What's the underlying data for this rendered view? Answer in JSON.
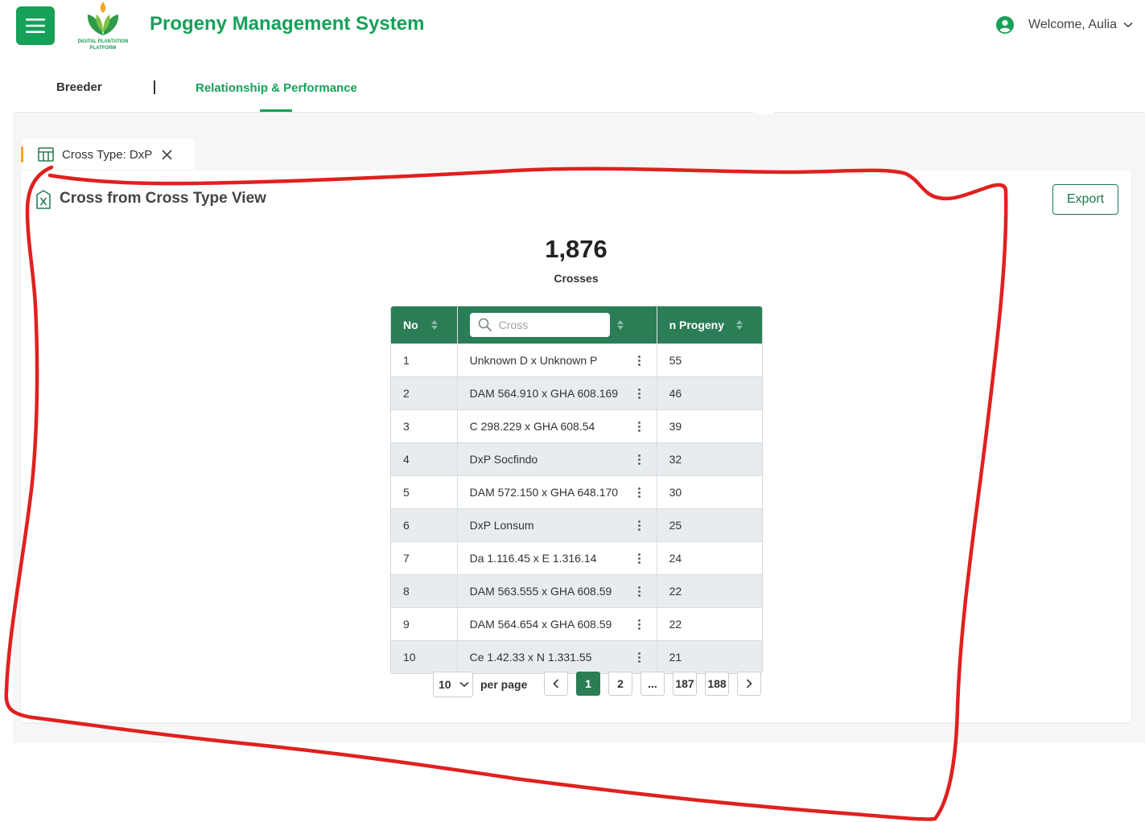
{
  "header": {
    "title": "Progeny Management System",
    "logo_caption": "DIGITAL PLANTATION PLATFORM",
    "user_greeting": "Welcome, Aulia"
  },
  "tabs": [
    {
      "label": "Breeder",
      "active": false
    },
    {
      "label": "Relationship & Performance",
      "active": true
    }
  ],
  "filter_chip": {
    "label": "Cross Type: DxP"
  },
  "card": {
    "title": "Cross from Cross Type View",
    "export_label": "Export",
    "total_value": "1,876",
    "total_label": "Crosses"
  },
  "table": {
    "columns": [
      "No",
      "Cross",
      "n Progeny"
    ],
    "search_placeholder": "Cross",
    "rows": [
      {
        "no": "1",
        "cross": "Unknown D x Unknown P",
        "n_progeny": "55"
      },
      {
        "no": "2",
        "cross": "DAM 564.910 x GHA 608.169",
        "n_progeny": "46"
      },
      {
        "no": "3",
        "cross": "C 298.229 x GHA 608.54",
        "n_progeny": "39"
      },
      {
        "no": "4",
        "cross": "DxP Socfindo",
        "n_progeny": "32"
      },
      {
        "no": "5",
        "cross": "DAM 572.150 x GHA 648.170",
        "n_progeny": "30"
      },
      {
        "no": "6",
        "cross": "DxP Lonsum",
        "n_progeny": "25"
      },
      {
        "no": "7",
        "cross": "Da 1.116.45 x E 1.316.14",
        "n_progeny": "24"
      },
      {
        "no": "8",
        "cross": "DAM 563.555 x GHA 608.59",
        "n_progeny": "22"
      },
      {
        "no": "9",
        "cross": "DAM 564.654 x GHA 608.59",
        "n_progeny": "22"
      },
      {
        "no": "10",
        "cross": "Ce 1.42.33 x N 1.331.55",
        "n_progeny": "21"
      }
    ]
  },
  "pagination": {
    "per_page": "10",
    "per_page_label": "per page",
    "pages": [
      "1",
      "2",
      "...",
      "187",
      "188"
    ],
    "current": "1"
  },
  "colors": {
    "brand_green": "#16a058",
    "table_header": "#2b7d56",
    "annotation_red": "#e02020",
    "chip_accent": "#f5a623"
  }
}
